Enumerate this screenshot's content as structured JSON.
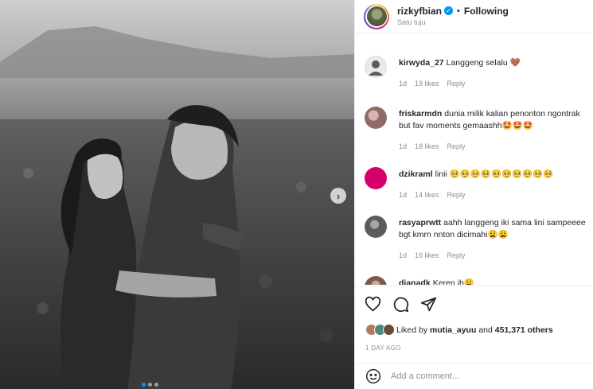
{
  "post": {
    "carousel_next": "›",
    "slide_count": 3,
    "active_slide": 1
  },
  "header": {
    "username": "rizkyfbian",
    "verified_icon": "✓",
    "separator": "•",
    "follow_state": "Following",
    "subline": "Satu tuju"
  },
  "comments": [
    {
      "user": "kirwyda_27",
      "text": "Langgeng selalu 🤎",
      "time": "1d",
      "likes": "19 likes",
      "reply": "Reply",
      "avatar_color": "#e9e9e9"
    },
    {
      "user": "friskarmdn",
      "text": "dunia milik kalian penonton ngontrak",
      "text2": "but fav moments gemaashh🤩🤩🤩",
      "time": "1d",
      "likes": "18 likes",
      "reply": "Reply",
      "avatar_color": "#b58a86"
    },
    {
      "user": "dzikraml",
      "text": "linii 🥺🥺🥺🥺🥺🥺🥺🥺🥺🥺",
      "time": "1d",
      "likes": "14 likes",
      "reply": "Reply",
      "avatar_color": "#d6006b"
    },
    {
      "user": "rasyaprwtt",
      "text": "aahh langgeng iki sama lini sampeeee",
      "text2": "bgt kmrn nnton dicimahi😩😩",
      "time": "1d",
      "likes": "16 likes",
      "reply": "Reply",
      "avatar_color": "#6c6c6c"
    },
    {
      "user": "dianadk",
      "text": "Keren ih😩",
      "avatar_color": "#8a6f60"
    }
  ],
  "actions": {
    "like_icon": "heart-icon",
    "comment_icon": "comment-icon",
    "share_icon": "share-icon",
    "liked_by_prefix": "Liked by",
    "liked_by_user": "mutia_ayuu",
    "and": "and",
    "others_count": "451,371 others",
    "date": "1 DAY AGO"
  },
  "add_comment": {
    "emoji_icon": "emoji-icon",
    "placeholder": "Add a comment..."
  }
}
